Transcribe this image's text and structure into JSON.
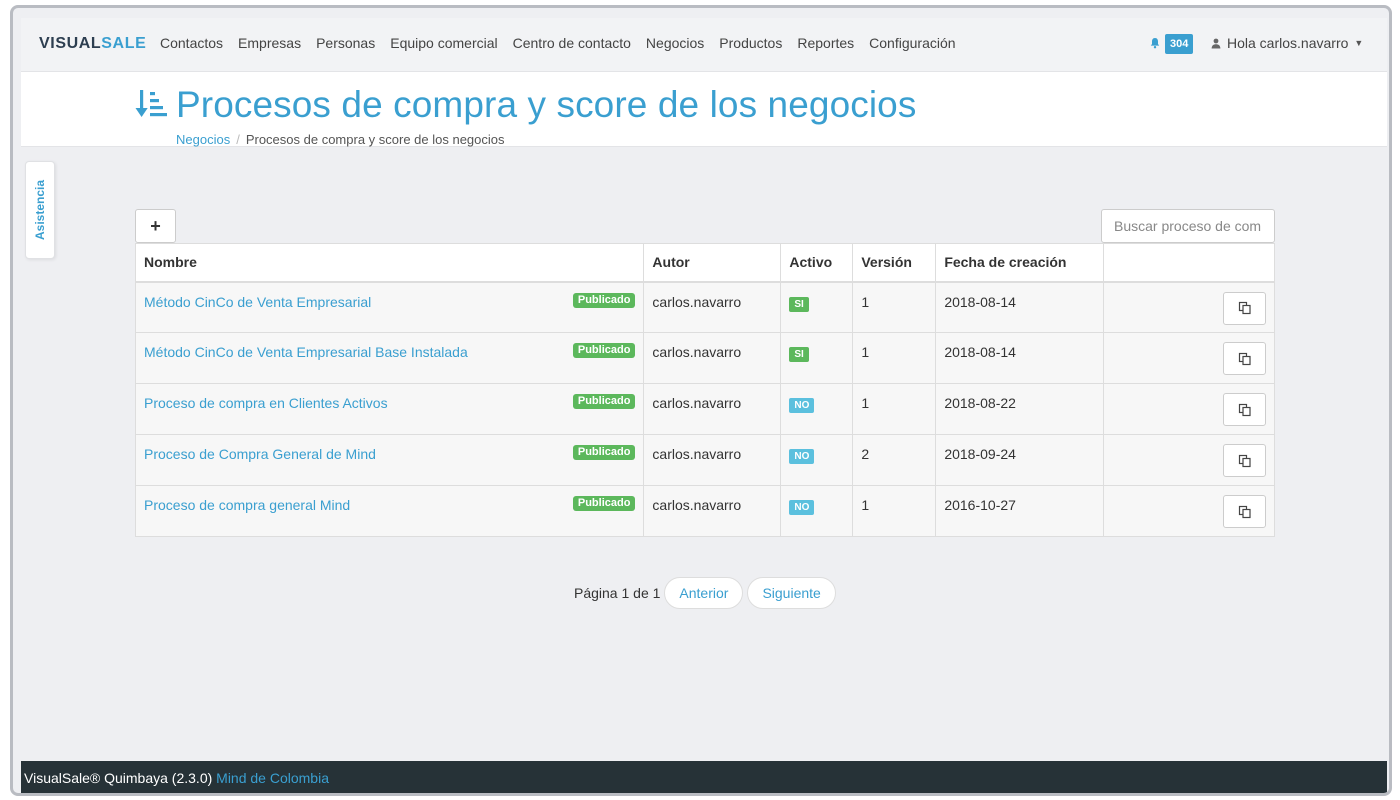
{
  "nav": {
    "brand_v": "V",
    "brand_isual": "ISUAL",
    "brand_sale": "SALE",
    "links": [
      "Contactos",
      "Empresas",
      "Personas",
      "Equipo comercial",
      "Centro de contacto",
      "Negocios",
      "Productos",
      "Reportes",
      "Configuración"
    ],
    "notifications": "304",
    "user": "Hola carlos.navarro"
  },
  "header": {
    "title": "Procesos de compra y score de los negocios",
    "breadcrumb_parent": "Negocios",
    "breadcrumb_current": "Procesos de compra y score de los negocios"
  },
  "side_tab": "Asistencia",
  "toolbar": {
    "add_label": "+",
    "search_placeholder": "Buscar proceso de com"
  },
  "table": {
    "headers": [
      "Nombre",
      "Autor",
      "Activo",
      "Versión",
      "Fecha de creación",
      ""
    ],
    "rows": [
      {
        "name": "Método CinCo de Venta Empresarial",
        "status": "Publicado",
        "author": "carlos.navarro",
        "active": "SI",
        "version": "1",
        "date": "2018-08-14"
      },
      {
        "name": "Método CinCo de Venta Empresarial Base Instalada",
        "status": "Publicado",
        "author": "carlos.navarro",
        "active": "SI",
        "version": "1",
        "date": "2018-08-14"
      },
      {
        "name": "Proceso de compra en Clientes Activos",
        "status": "Publicado",
        "author": "carlos.navarro",
        "active": "NO",
        "version": "1",
        "date": "2018-08-22"
      },
      {
        "name": "Proceso de Compra General de Mind",
        "status": "Publicado",
        "author": "carlos.navarro",
        "active": "NO",
        "version": "2",
        "date": "2018-09-24"
      },
      {
        "name": "Proceso de compra general Mind",
        "status": "Publicado",
        "author": "carlos.navarro",
        "active": "NO",
        "version": "1",
        "date": "2016-10-27"
      }
    ]
  },
  "pagination": {
    "info": "Página 1 de 1",
    "prev": "Anterior",
    "next": "Siguiente"
  },
  "footer": {
    "text": "VisualSale® Quimbaya (2.3.0) ",
    "link": "Mind de Colombia"
  },
  "colors": {
    "accent": "#3a9fd0",
    "success": "#5cb85c",
    "info": "#5bc0de",
    "footer_bg": "#263237"
  }
}
